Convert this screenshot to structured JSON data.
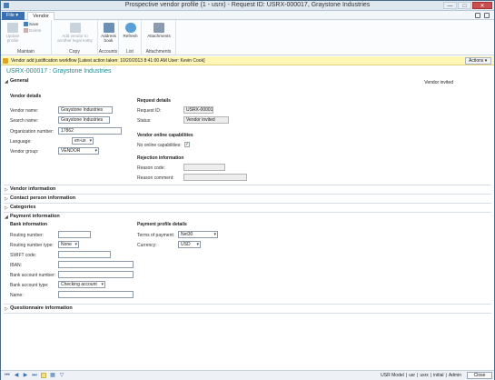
{
  "window": {
    "title": "Prospective vendor profile (1 - usrx) - Request ID: USRX-000017, Graystone Industries",
    "minimize": "—",
    "maximize": "□",
    "close": "✕"
  },
  "tabs": {
    "file": "File ▾",
    "vendor": "Vendor"
  },
  "ribbon": {
    "maintain": {
      "label": "Maintain",
      "update_profile": "Update profile",
      "save": "Save",
      "delete": "Delete"
    },
    "copy": {
      "label": "Copy",
      "add_vendor": "Add vendor to another legal entity"
    },
    "accounts": {
      "label": "Accounts",
      "address_book": "Address book"
    },
    "list": {
      "label": "List",
      "refresh": "Refresh"
    },
    "attachments": {
      "label": "Attachments",
      "attachments": "Attachments"
    }
  },
  "infobar": {
    "text": "Vendor add justification workflow  [Latest action taken: 10/20/2013 8:41:00 AM  User: Kevin Cook]",
    "actions": "Actions ▾"
  },
  "record_title": "USRX-000017 : Graystone Industries",
  "general": {
    "title": "General",
    "status_text": "Vendor invited",
    "vendor_details": {
      "heading": "Vendor details",
      "vendor_name_label": "Vendor name:",
      "vendor_name": "Graystone Industries",
      "search_name_label": "Search name:",
      "search_name": "Graystone Industries",
      "org_number_label": "Organization number:",
      "org_number": "17862",
      "language_label": "Language:",
      "language": "en-us",
      "vendor_group_label": "Vendor group:",
      "vendor_group": "VENDOR"
    },
    "request_details": {
      "heading": "Request details",
      "request_id_label": "Request ID:",
      "request_id": "USRX-00001",
      "status_label": "Status:",
      "status": "Vendor invited"
    },
    "online": {
      "heading": "Vendor online capabilities",
      "no_online_label": "No online capabilities:",
      "checkmark": "✓"
    },
    "rejection": {
      "heading": "Rejection information",
      "reason_code_label": "Reason code:",
      "reason_code": "",
      "reason_comment_label": "Reason comment:",
      "reason_comment": ""
    }
  },
  "sections": {
    "vendor_info": "Vendor information",
    "contact_person": "Contact person information",
    "categories": "Categories",
    "payment": "Payment information",
    "questionnaire": "Questionnaire information"
  },
  "payment": {
    "bank": {
      "heading": "Bank information",
      "routing_number_label": "Routing number:",
      "routing_number": "",
      "routing_type_label": "Routing number type:",
      "routing_type": "None",
      "swift_label": "SWIFT code:",
      "swift": "",
      "iban_label": "IBAN:",
      "iban": "",
      "account_number_label": "Bank account number:",
      "account_number": "",
      "account_type_label": "Bank account type:",
      "account_type": "Checking account",
      "name_label": "Name:",
      "name": ""
    },
    "profile": {
      "heading": "Payment profile details",
      "terms_label": "Terms of payment:",
      "terms": "Net30",
      "currency_label": "Currency:",
      "currency": "USD"
    }
  },
  "statusbar": {
    "segments": [
      "USR Model",
      "usr",
      "usrx",
      "initial",
      "Admin"
    ],
    "close": "Close"
  },
  "triangles": {
    "open": "◢",
    "closed": "▷"
  }
}
